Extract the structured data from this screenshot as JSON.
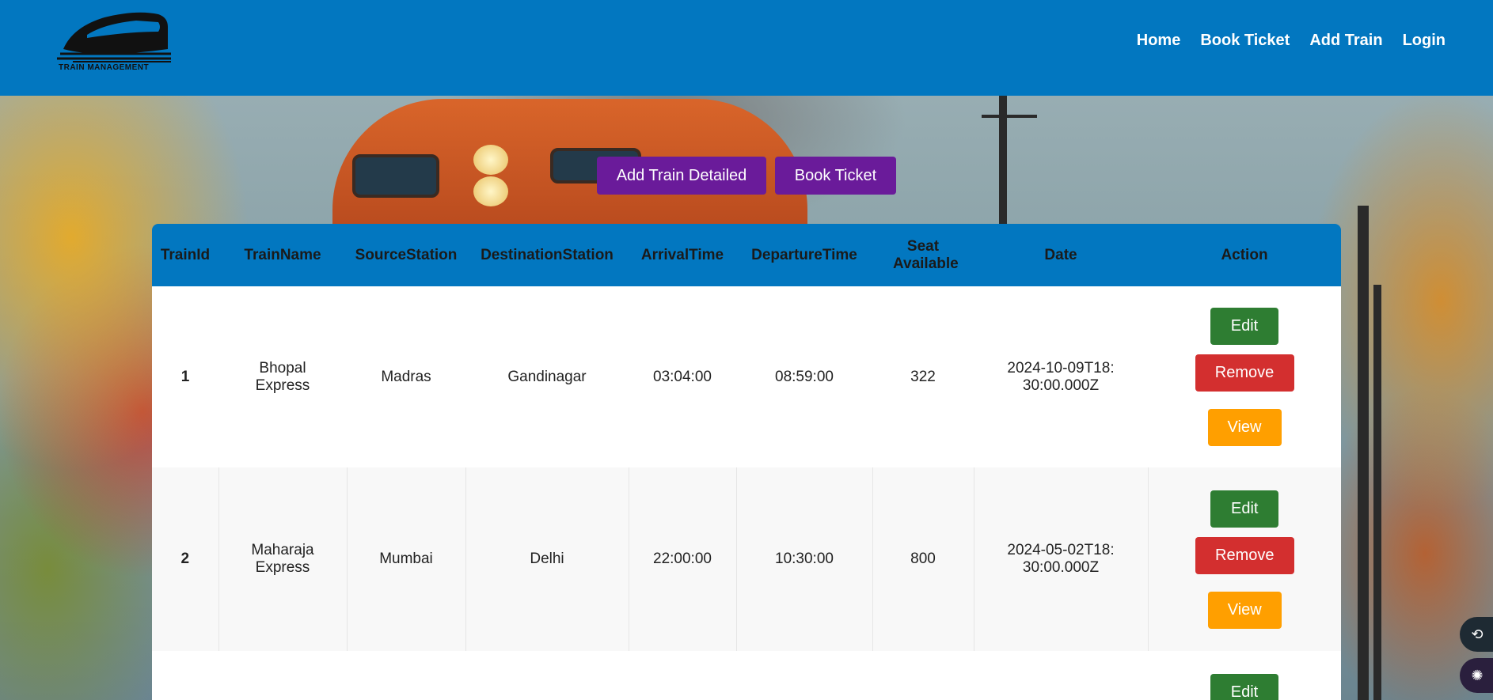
{
  "header": {
    "logo_text": "TRAIN MANAGEMENT",
    "nav": [
      "Home",
      "Book Ticket",
      "Add Train",
      "Login"
    ]
  },
  "actions": {
    "add_train_detailed": "Add Train Detailed",
    "book_ticket": "Book Ticket"
  },
  "table": {
    "headers": [
      "TrainId",
      "TrainName",
      "SourceStation",
      "DestinationStation",
      "ArrivalTime",
      "DepartureTime",
      "Seat Available",
      "Date",
      "Action"
    ],
    "rows": [
      {
        "id": "1",
        "name": "Bhopal Express",
        "source": "Madras",
        "destination": "Gandinagar",
        "arrival": "03:04:00",
        "departure": "08:59:00",
        "seats": "322",
        "date": "2024-10-09T18:30:00.000Z"
      },
      {
        "id": "2",
        "name": "Maharaja Express",
        "source": "Mumbai",
        "destination": "Delhi",
        "arrival": "22:00:00",
        "departure": "10:30:00",
        "seats": "800",
        "date": "2024-05-02T18:30:00.000Z"
      }
    ],
    "row_actions": {
      "edit": "Edit",
      "remove": "Remove",
      "view": "View"
    }
  },
  "colors": {
    "navbar": "#0277c0",
    "purple_button": "#6a1b9a",
    "edit": "#2e7d32",
    "remove": "#d32f2f",
    "view": "#ff9f00"
  },
  "icons": [
    "train-logo-icon",
    "translate-icon",
    "brain-icon"
  ]
}
